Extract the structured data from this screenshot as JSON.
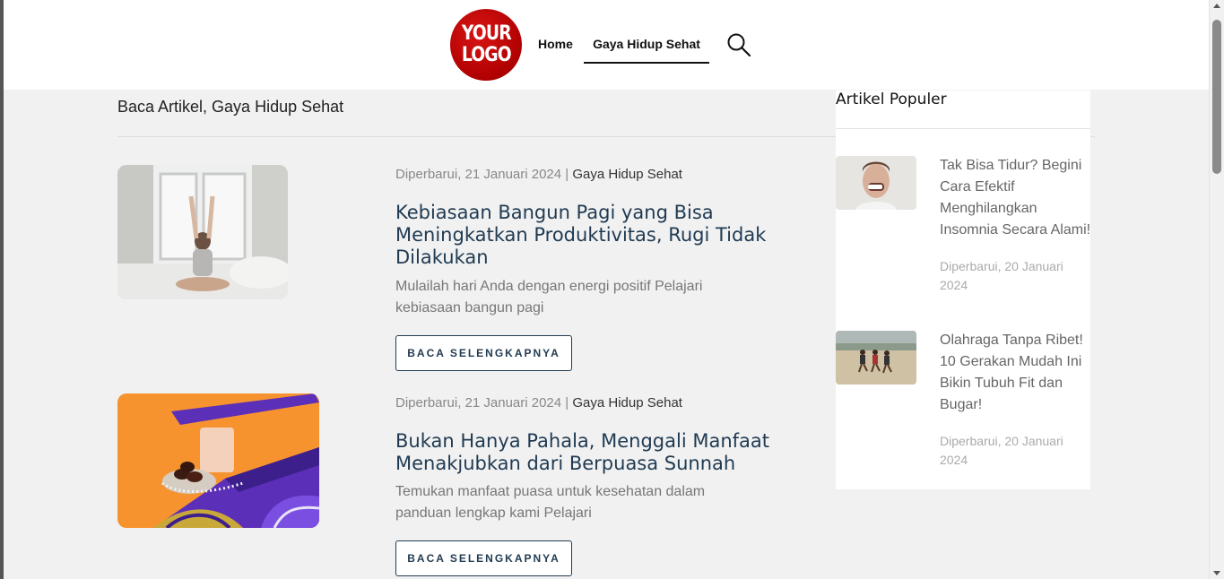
{
  "header": {
    "logo_line1": "YOUR",
    "logo_line2": "LOGO",
    "nav": [
      {
        "label": "Home"
      },
      {
        "label": "Gaya Hidup Sehat"
      }
    ]
  },
  "breadcrumb": "Baca Artikel, Gaya Hidup Sehat",
  "posts": [
    {
      "date": "Diperbarui, 21 Januari 2024",
      "separator": "|",
      "category": "Gaya Hidup Sehat",
      "title": "Kebiasaan Bangun Pagi yang Bisa Meningkatkan Produktivitas, Rugi Tidak Dilakukan",
      "excerpt": "Mulailah hari Anda dengan energi positif Pelajari kebiasaan bangun pagi",
      "button": "BACA SELENGKAPNYA"
    },
    {
      "date": "Diperbarui, 21 Januari 2024",
      "separator": "|",
      "category": "Gaya Hidup Sehat",
      "title": "Bukan Hanya Pahala, Menggali Manfaat Menakjubkan dari Berpuasa Sunnah",
      "excerpt": "Temukan manfaat puasa untuk kesehatan dalam panduan lengkap kami Pelajari",
      "button": "BACA SELENGKAPNYA"
    }
  ],
  "sidebar": {
    "title": "Artikel Populer",
    "items": [
      {
        "title": "Tak Bisa Tidur? Begini Cara Efektif Menghilangkan Insomnia Secara Alami!",
        "date": "Diperbarui, 20 Januari 2024"
      },
      {
        "title": "Olahraga Tanpa Ribet! 10 Gerakan Mudah Ini Bikin Tubuh Fit dan Bugar!",
        "date": "Diperbarui, 20 Januari 2024"
      }
    ]
  },
  "icons": {
    "search": "search-icon"
  },
  "colors": {
    "logo": "#b00000",
    "title": "#1f3a52",
    "background": "#f1f1f1"
  }
}
